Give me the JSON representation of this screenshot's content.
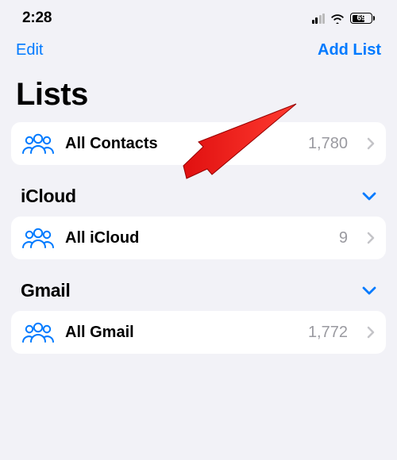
{
  "status": {
    "time": "2:28",
    "battery": "69"
  },
  "nav": {
    "left": "Edit",
    "right": "Add List"
  },
  "title": "Lists",
  "allContacts": {
    "label": "All Contacts",
    "count": "1,780"
  },
  "sections": [
    {
      "title": "iCloud",
      "row": {
        "label": "All iCloud",
        "count": "9"
      }
    },
    {
      "title": "Gmail",
      "row": {
        "label": "All Gmail",
        "count": "1,772"
      }
    }
  ]
}
